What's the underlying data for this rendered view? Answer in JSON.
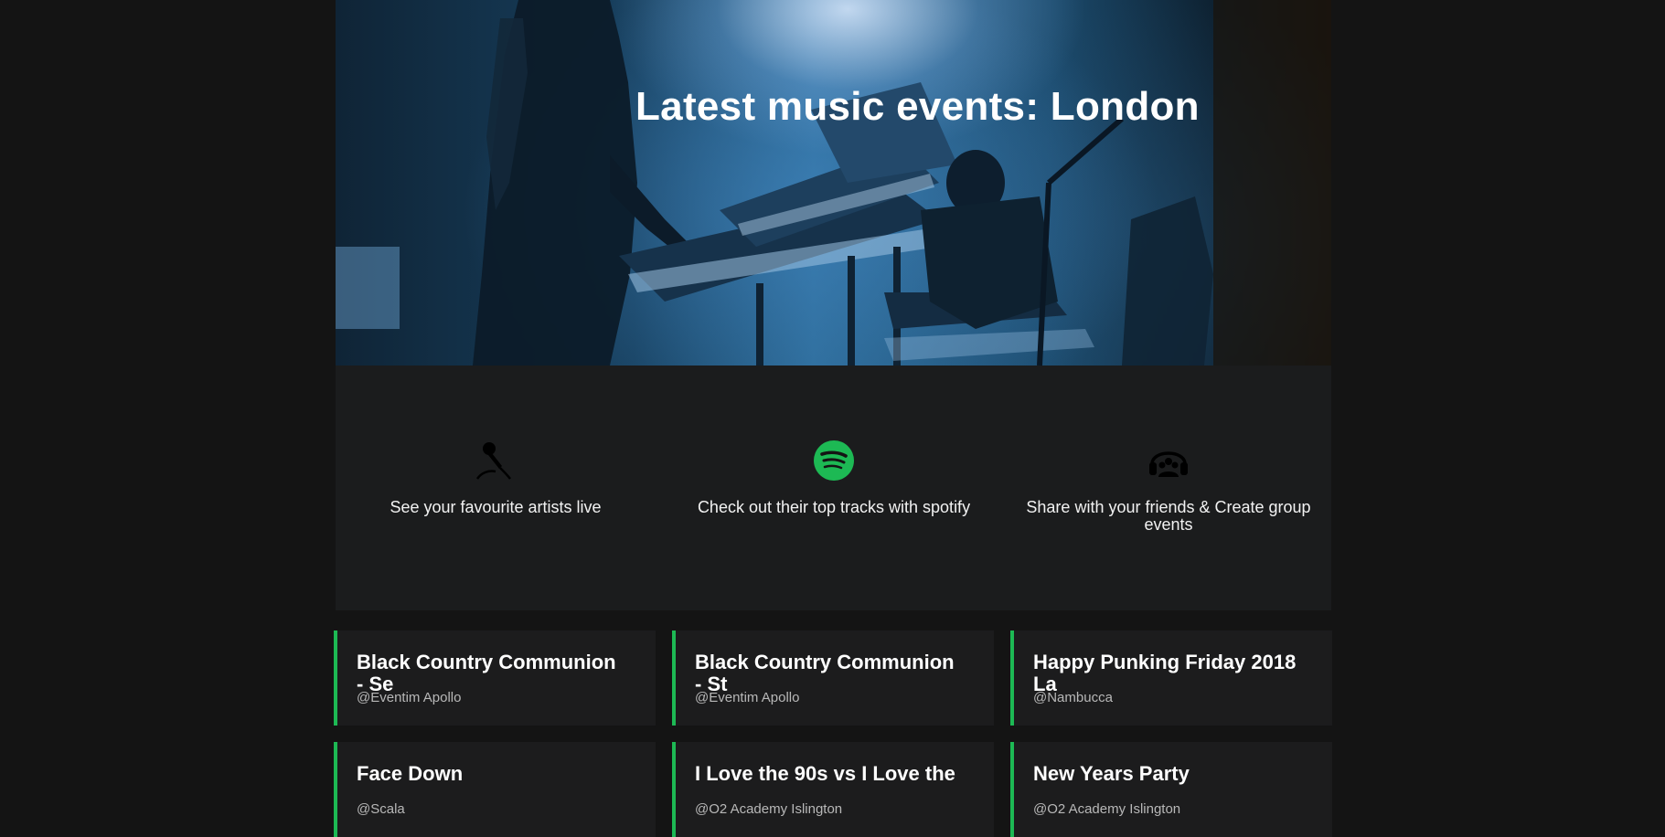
{
  "hero": {
    "title": "Latest music events: London"
  },
  "features": [
    {
      "icon": "microphone-icon",
      "text": "See your favourite artists live"
    },
    {
      "icon": "spotify-icon",
      "text": "Check out their top tracks with spotify",
      "color": "#1db954"
    },
    {
      "icon": "headphones-group-icon",
      "text": "Share with your friends & Create group events"
    }
  ],
  "events": [
    {
      "title": "Black Country Communion\n- Se",
      "venue": "@Eventim Apollo"
    },
    {
      "title": "Black Country Communion\n- St",
      "venue": "@Eventim Apollo"
    },
    {
      "title": "Happy Punking Friday 2018\nLa",
      "venue": "@Nambucca"
    },
    {
      "title": "Face Down",
      "venue": "@Scala"
    },
    {
      "title": "I Love the 90s vs I Love the",
      "venue": "@O2 Academy Islington"
    },
    {
      "title": "New Years Party",
      "venue": "@O2 Academy Islington"
    }
  ],
  "colors": {
    "accent": "#1db954",
    "background": "#141414",
    "panel": "#1b1c1d"
  }
}
